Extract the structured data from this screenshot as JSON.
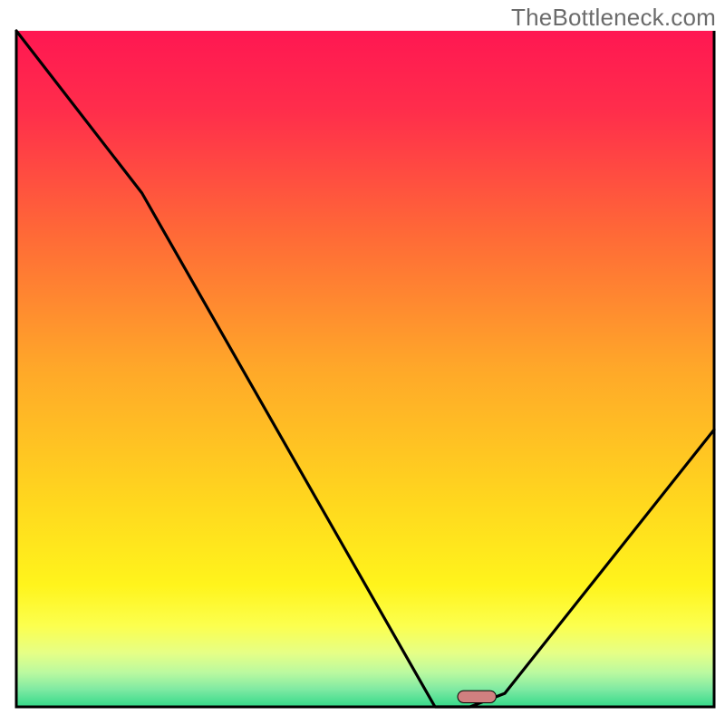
{
  "watermark": "TheBottleneck.com",
  "chart_data": {
    "type": "line",
    "title": "",
    "xlabel": "",
    "ylabel": "",
    "xlim": [
      0,
      100
    ],
    "ylim": [
      0,
      100
    ],
    "grid": false,
    "legend": false,
    "series": [
      {
        "name": "bottleneck-percentage",
        "x": [
          0,
          18,
          60,
          65,
          70,
          100
        ],
        "y": [
          100,
          76,
          0,
          0,
          2,
          41
        ],
        "color": "#000000"
      }
    ],
    "marker": {
      "name": "optimal-point",
      "x": 66,
      "y": 1.5,
      "color": "#d08080",
      "width_pct": 5.5,
      "height_pct": 1.8
    },
    "background_gradient": {
      "stops": [
        {
          "offset": 0.0,
          "color": "#ff1752"
        },
        {
          "offset": 0.12,
          "color": "#ff2e4b"
        },
        {
          "offset": 0.3,
          "color": "#ff6937"
        },
        {
          "offset": 0.5,
          "color": "#ffa829"
        },
        {
          "offset": 0.7,
          "color": "#ffd81e"
        },
        {
          "offset": 0.82,
          "color": "#fff41c"
        },
        {
          "offset": 0.88,
          "color": "#fcff4e"
        },
        {
          "offset": 0.92,
          "color": "#e6ff86"
        },
        {
          "offset": 0.95,
          "color": "#b9f9a0"
        },
        {
          "offset": 0.975,
          "color": "#7de9a2"
        },
        {
          "offset": 1.0,
          "color": "#33d989"
        }
      ]
    },
    "frame": {
      "stroke": "#000000",
      "stroke_width": 3
    }
  },
  "colors": {
    "curve": "#000000",
    "marker_fill": "#d08080",
    "marker_stroke": "#000000",
    "watermark_text": "#6b6b6b"
  }
}
